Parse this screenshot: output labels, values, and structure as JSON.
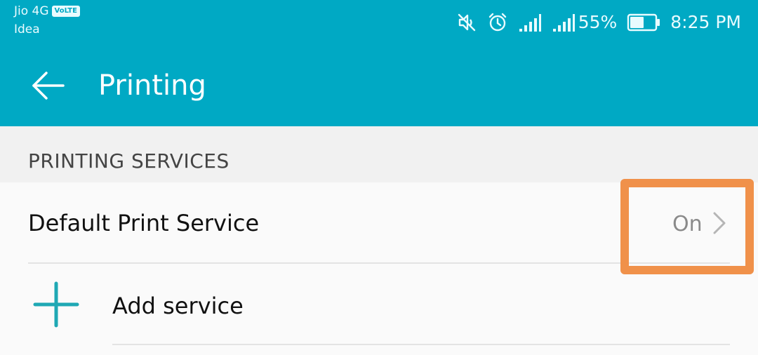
{
  "status_bar": {
    "carrier_1": "Jio 4G",
    "volte_badge": "VoLTE",
    "carrier_2": "Idea",
    "battery_percent": "55%",
    "time": "8:25 PM",
    "icons": [
      "mute-icon",
      "alarm-icon",
      "signal-icon",
      "signal-icon",
      "battery-icon"
    ],
    "battery_level": 0.55
  },
  "app_bar": {
    "title": "Printing",
    "back_icon": "back-arrow-icon",
    "color": "#00a9c4"
  },
  "section": {
    "header": "PRINTING SERVICES"
  },
  "items": [
    {
      "label": "Default Print Service",
      "value": "On",
      "icon": "chevron-right-icon"
    },
    {
      "label": "Add service",
      "icon": "plus-icon",
      "icon_color": "#1fa8b4"
    }
  ],
  "highlight": {
    "color": "#f0914a"
  }
}
